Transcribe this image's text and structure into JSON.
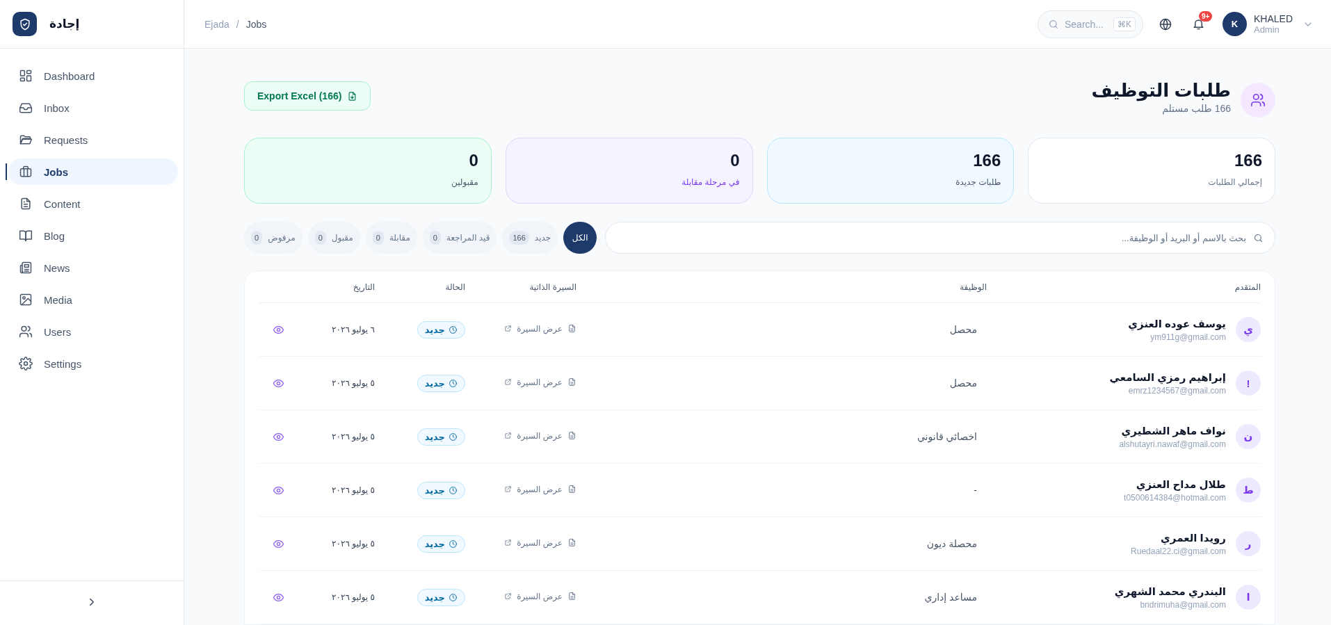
{
  "sidebar": {
    "logo_text": "إجادة",
    "items": [
      {
        "label": "Dashboard",
        "selected": false
      },
      {
        "label": "Inbox",
        "selected": false
      },
      {
        "label": "Requests",
        "selected": false
      },
      {
        "label": "Jobs",
        "selected": true
      },
      {
        "label": "Content",
        "selected": false
      },
      {
        "label": "Blog",
        "selected": false
      },
      {
        "label": "News",
        "selected": false
      },
      {
        "label": "Media",
        "selected": false
      },
      {
        "label": "Users",
        "selected": false
      },
      {
        "label": "Settings",
        "selected": false
      }
    ]
  },
  "header": {
    "breadcrumb": {
      "root": "Ejada",
      "separator": "/",
      "current": "Jobs"
    },
    "search": {
      "placeholder": "Search...",
      "shortcut": "⌘K"
    },
    "notification_badge": "9+",
    "user": {
      "initial": "K",
      "name": "KHALED",
      "role": "Admin"
    }
  },
  "page": {
    "title": "طلبات التوظيف",
    "subtitle": "166 طلب مستلم",
    "export_button": "Export Excel (166)"
  },
  "stats": [
    {
      "kind": "total",
      "value": "166",
      "label": "إجمالي الطلبات"
    },
    {
      "kind": "new",
      "value": "166",
      "label": "طلبات جديدة"
    },
    {
      "kind": "interview",
      "value": "0",
      "label": "في مرحلة مقابلة"
    },
    {
      "kind": "accepted",
      "value": "0",
      "label": "مقبولين"
    }
  ],
  "search": {
    "placeholder": "بحث بالاسم أو البريد أو الوظيفة..."
  },
  "filters": [
    {
      "label": "الكل",
      "selected": true
    },
    {
      "label": "جديد",
      "count": "166",
      "selected": false
    },
    {
      "label": "قيد المراجعة",
      "count": "0",
      "selected": false
    },
    {
      "label": "مقابلة",
      "count": "0",
      "selected": false
    },
    {
      "label": "مقبول",
      "count": "0",
      "selected": false
    },
    {
      "label": "مرفوض",
      "count": "0",
      "selected": false
    }
  ],
  "table": {
    "columns": [
      "المتقدم",
      "الوظيفة",
      "السيرة الذاتية",
      "الحالة",
      "التاريخ"
    ],
    "rows": [
      {
        "initial": "ي",
        "name": "يوسف عوده العنزي",
        "email": "ym911g@gmail.com",
        "job": "محصل",
        "cv": "عرض السيرة",
        "status": "جديد",
        "date": "٦ يوليو ٢٠٢٦"
      },
      {
        "initial": "!",
        "name": "إبراهيم رمزي السامعي",
        "email": "emrz1234567@gmail.com",
        "job": "محصل",
        "cv": "عرض السيرة",
        "status": "جديد",
        "date": "٥ يوليو ٢٠٢٦"
      },
      {
        "initial": "ن",
        "name": "نواف ماهر الشطيري",
        "email": "alshutayri.nawaf@gmail.com",
        "job": "اخصائي قانوني",
        "cv": "عرض السيرة",
        "status": "جديد",
        "date": "٥ يوليو ٢٠٢٦"
      },
      {
        "initial": "ط",
        "name": "طلال مداح العنزي",
        "email": "t0500614384@hotmail.com",
        "job": "-",
        "cv": "عرض السيرة",
        "status": "جديد",
        "date": "٥ يوليو ٢٠٢٦"
      },
      {
        "initial": "ر",
        "name": "رويدا العمري",
        "email": "Ruedaal22.ci@gmail.com",
        "job": "محصلة ديون",
        "cv": "عرض السيرة",
        "status": "جديد",
        "date": "٥ يوليو ٢٠٢٦"
      },
      {
        "initial": "ا",
        "name": "البندري محمد الشهري",
        "email": "bndrimuha@gmail.com",
        "job": "مساعد إداري",
        "cv": "عرض السيرة",
        "status": "جديد",
        "date": "٥ يوليو ٢٠٢٦"
      }
    ]
  }
}
